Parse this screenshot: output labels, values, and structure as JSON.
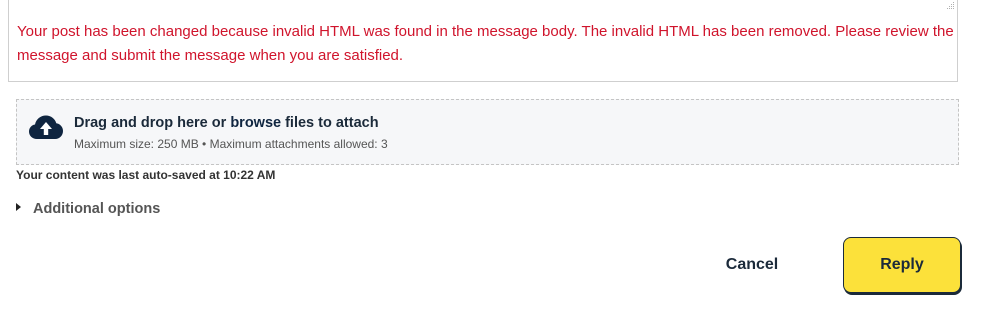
{
  "editor": {
    "error_message": "Your post has been changed because invalid HTML was found in the message body. The invalid HTML has been removed. Please review the message and submit the message when you are satisfied."
  },
  "attachments": {
    "prefix": "Drag and drop here or ",
    "browse_link": "browse",
    "suffix": " files to attach",
    "limits": "Maximum size: 250 MB • Maximum attachments allowed: 3",
    "icon": "cloud-upload-icon"
  },
  "autosave": "Your content was last auto-saved at 10:22 AM",
  "additional_options": {
    "label": "Additional options",
    "icon": "caret-right-icon"
  },
  "actions": {
    "cancel_label": "Cancel",
    "reply_label": "Reply",
    "reply_color": "#fce13a",
    "error_color": "#d0142c"
  }
}
